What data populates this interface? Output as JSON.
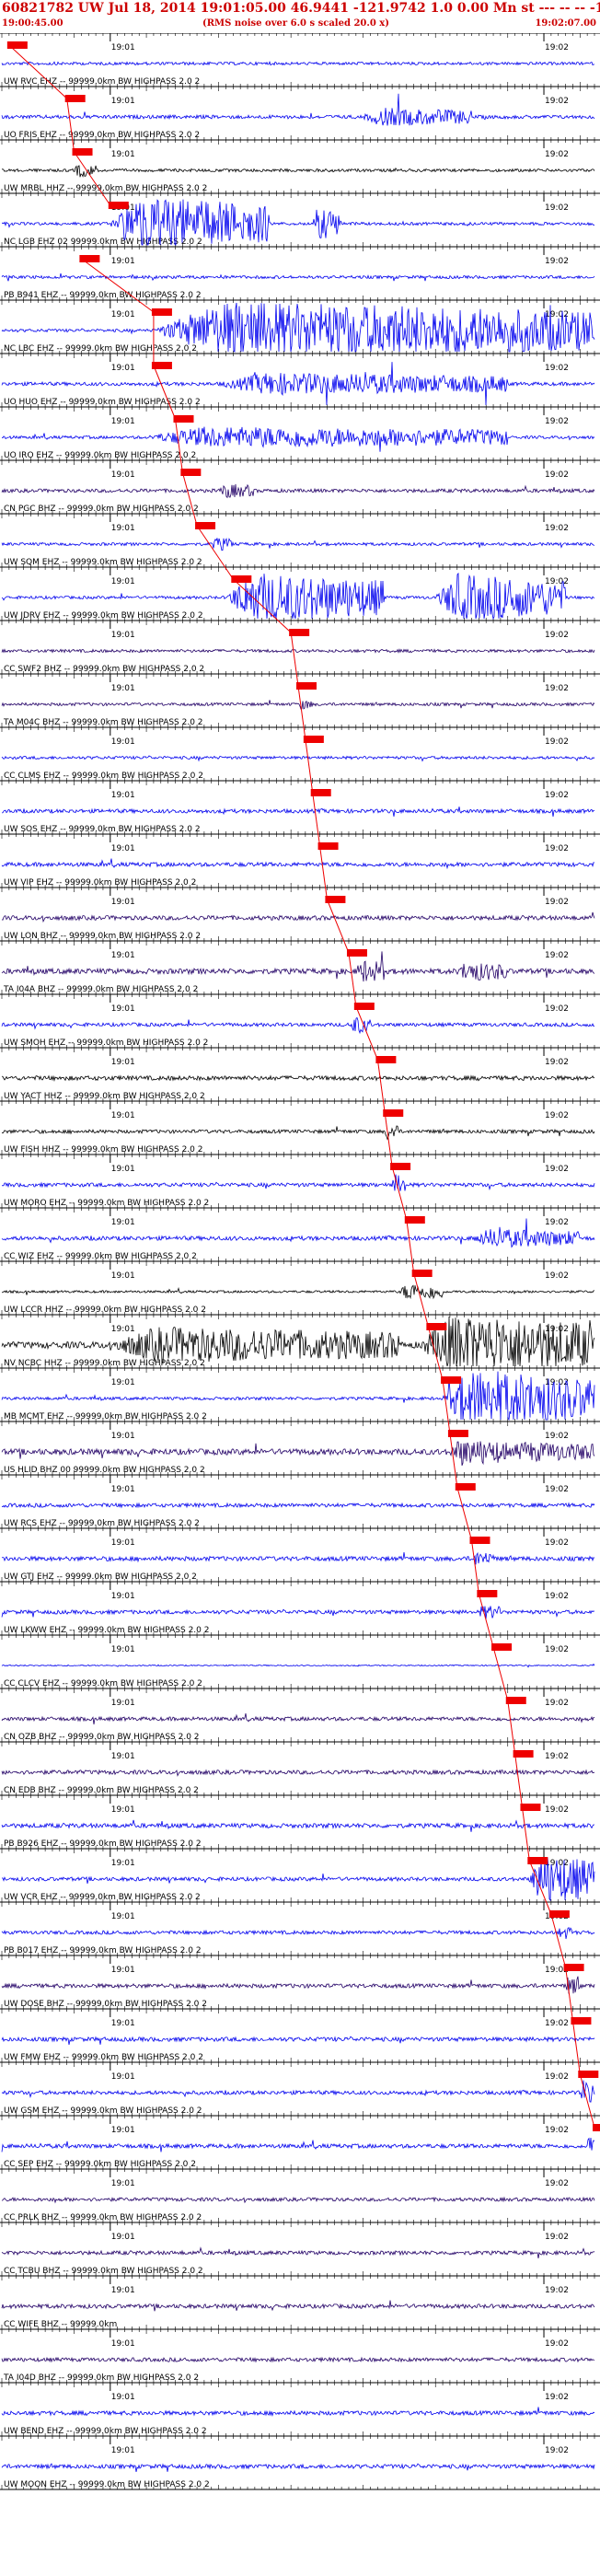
{
  "header": {
    "title": "60821782 UW Jul 18, 2014 19:01:05.00   46.9441 -121.9742  1.0 0.00 Mn st --- -- --  -1",
    "start_time": "19:00:45.00",
    "noise_note": "(RMS noise over 6.0 s scaled 20.0 x)",
    "end_time": "19:02:07.00"
  },
  "colors": {
    "pick": "#ee0000",
    "blue": "#0000ee",
    "dark": "#220066",
    "black": "#000000"
  },
  "chart_data": {
    "type": "line",
    "x_range": [
      "19:00:45.00",
      "19:02:07.00"
    ],
    "tick_labels": [
      "19:01",
      "19:02"
    ],
    "origin_time": "19:01:05.00",
    "traces": [
      {
        "label": "UW RVC EHZ -- 99999.0km BW  HIGHPASS  2.0  2",
        "pick": "19:00:46",
        "amp": 1.0,
        "burst": [],
        "color": "blue"
      },
      {
        "label": "UO FRIS EHZ -- 99999.0km BW  HIGHPASS  2.0  2",
        "pick": "19:00:54",
        "amp": 1.2,
        "burst": [
          [
            "19:01:35",
            "19:01:50",
            4
          ]
        ],
        "color": "blue"
      },
      {
        "label": "UW MRBL HHZ -- 99999.0km BW  HIGHPASS  2.0  2",
        "pick": "19:00:55",
        "amp": 1.0,
        "burst": [
          [
            "19:00:55",
            "19:00:58",
            3
          ]
        ],
        "color": "black"
      },
      {
        "label": "NC LGB EHZ 02 99999.0km BW  HIGHPASS  2.0  2",
        "pick": "19:01:00",
        "amp": 1.0,
        "burst": [
          [
            "19:01:00",
            "19:01:22",
            14
          ],
          [
            "19:01:28",
            "19:01:32",
            8
          ]
        ],
        "color": "blue"
      },
      {
        "label": "PB B941 EHZ -- 99999.0km BW  HIGHPASS  2.0  2",
        "pick": "19:00:56",
        "amp": 1.0,
        "burst": [],
        "color": "blue"
      },
      {
        "label": "NC LBC EHZ -- 99999.0km BW  HIGHPASS  2.0  2",
        "pick": "19:01:06",
        "amp": 1.0,
        "burst": [
          [
            "19:01:06",
            "19:02:07",
            15
          ]
        ],
        "color": "blue"
      },
      {
        "label": "UO HUO EHZ -- 99999.0km BW  HIGHPASS  2.0  2",
        "pick": "19:01:06",
        "amp": 1.2,
        "burst": [
          [
            "19:01:15",
            "19:01:55",
            5
          ]
        ],
        "color": "blue"
      },
      {
        "label": "UO IRO EHZ -- 99999.0km BW  HIGHPASS  2.0  2",
        "pick": "19:01:09",
        "amp": 1.0,
        "burst": [
          [
            "19:01:05",
            "19:01:55",
            5
          ]
        ],
        "color": "blue"
      },
      {
        "label": "CN PGC BHZ -- 99999.0km BW  HIGHPASS  2.0  2",
        "pick": "19:01:10",
        "amp": 1.2,
        "burst": [
          [
            "19:01:15",
            "19:01:20",
            3
          ]
        ],
        "color": "dark"
      },
      {
        "label": "UW SQM EHZ -- 99999.0km BW  HIGHPASS  2.0  2",
        "pick": "19:01:12",
        "amp": 1.0,
        "burst": [
          [
            "19:01:14",
            "19:01:17",
            3
          ]
        ],
        "color": "blue"
      },
      {
        "label": "UW JDRV EHZ -- 99999.0km BW  HIGHPASS  2.0  2",
        "pick": "19:01:17",
        "amp": 1.0,
        "burst": [
          [
            "19:01:16",
            "19:01:38",
            13
          ],
          [
            "19:01:45",
            "19:02:03",
            12
          ]
        ],
        "color": "blue"
      },
      {
        "label": "CC SWF2 BHZ -- 99999.0km BW  HIGHPASS  2.0  2",
        "pick": "19:01:25",
        "amp": 1.0,
        "burst": [],
        "color": "dark"
      },
      {
        "label": "TA M04C BHZ -- 99999.0km BW  HIGHPASS  2.0  2",
        "pick": "19:01:26",
        "amp": 1.0,
        "burst": [
          [
            "19:01:26",
            "19:01:28",
            2
          ]
        ],
        "color": "dark"
      },
      {
        "label": "CC CLMS EHZ -- 99999.0km BW  HIGHPASS  2.0  2",
        "pick": "19:01:27",
        "amp": 1.0,
        "burst": [],
        "color": "blue"
      },
      {
        "label": "UW SOS EHZ -- 99999.0km BW  HIGHPASS  2.0  2",
        "pick": "19:01:28",
        "amp": 1.3,
        "burst": [],
        "color": "blue"
      },
      {
        "label": "UW VIP EHZ -- 99999.0km BW  HIGHPASS  2.0  2",
        "pick": "19:01:29",
        "amp": 1.4,
        "burst": [],
        "color": "blue"
      },
      {
        "label": "UW LON BHZ -- 99999.0km BW  HIGHPASS  2.0  2",
        "pick": "19:01:30",
        "amp": 1.5,
        "burst": [],
        "color": "dark"
      },
      {
        "label": "TA I04A BHZ -- 99999.0km BW  HIGHPASS  2.0  2",
        "pick": "19:01:33",
        "amp": 1.8,
        "burst": [
          [
            "19:01:34",
            "19:01:38",
            5
          ],
          [
            "19:01:48",
            "19:01:55",
            4
          ]
        ],
        "color": "dark"
      },
      {
        "label": "UW SMOH EHZ -- 99999.0km BW  HIGHPASS  2.0  2",
        "pick": "19:01:34",
        "amp": 1.2,
        "burst": [
          [
            "19:01:33",
            "19:01:36",
            4
          ]
        ],
        "color": "blue"
      },
      {
        "label": "UW YACT HHZ -- 99999.0km BW  HIGHPASS  2.0  2",
        "pick": "19:01:37",
        "amp": 1.5,
        "burst": [],
        "color": "black"
      },
      {
        "label": "UW FISH HHZ -- 99999.0km BW  HIGHPASS  2.0  2",
        "pick": "19:01:38",
        "amp": 1.2,
        "burst": [
          [
            "19:01:38",
            "19:01:40",
            4
          ]
        ],
        "color": "black"
      },
      {
        "label": "UW MORO EHZ -- 99999.0km BW  HIGHPASS  2.0  2",
        "pick": "19:01:39",
        "amp": 1.3,
        "burst": [
          [
            "19:01:39",
            "19:01:41",
            5
          ]
        ],
        "color": "blue"
      },
      {
        "label": "CC WIZ EHZ -- 99999.0km BW  HIGHPASS  2.0  2",
        "pick": "19:01:41",
        "amp": 1.4,
        "burst": [
          [
            "19:01:50",
            "19:02:05",
            4
          ]
        ],
        "color": "blue"
      },
      {
        "label": "UW LCCR HHZ -- 99999.0km BW  HIGHPASS  2.0  2",
        "pick": "19:01:42",
        "amp": 0.8,
        "burst": [
          [
            "19:01:40",
            "19:01:46",
            4
          ]
        ],
        "color": "black"
      },
      {
        "label": "NV NCBC HHZ -- 99999.0km BW  HIGHPASS  2.0  2",
        "pick": "19:01:44",
        "amp": 2.2,
        "burst": [
          [
            "19:01:00",
            "19:01:40",
            8
          ],
          [
            "19:01:43",
            "19:02:07",
            15
          ]
        ],
        "color": "black"
      },
      {
        "label": "MB MCMT EHZ -- 99999.0km BW  HIGHPASS  2.0  2",
        "pick": "19:01:46",
        "amp": 1.0,
        "burst": [
          [
            "19:01:46",
            "19:02:07",
            15
          ]
        ],
        "color": "blue"
      },
      {
        "label": "US HLID BHZ 00 99999.0km BW  HIGHPASS  2.0  2",
        "pick": "19:01:47",
        "amp": 2.0,
        "burst": [
          [
            "19:01:47",
            "19:01:55",
            6
          ],
          [
            "19:01:55",
            "19:02:07",
            4
          ]
        ],
        "color": "dark"
      },
      {
        "label": "UW RCS EHZ -- 99999.0km BW  HIGHPASS  2.0  2",
        "pick": "19:01:48",
        "amp": 1.3,
        "burst": [],
        "color": "blue"
      },
      {
        "label": "UW GTJ EHZ -- 99999.0km BW  HIGHPASS  2.0  2",
        "pick": "19:01:50",
        "amp": 1.5,
        "burst": [
          [
            "19:01:50",
            "19:01:53",
            3
          ]
        ],
        "color": "blue"
      },
      {
        "label": "UW LKWW EHZ -- 99999.0km BW  HIGHPASS  2.0  2",
        "pick": "19:01:51",
        "amp": 1.3,
        "burst": [
          [
            "19:01:51",
            "19:01:54",
            3
          ]
        ],
        "color": "blue"
      },
      {
        "label": "CC CLCV EHZ -- 99999.0km BW  HIGHPASS  2.0  2",
        "pick": "19:01:53",
        "amp": 0.4,
        "burst": [],
        "color": "blue"
      },
      {
        "label": "CN OZB BHZ -- 99999.0km BW  HIGHPASS  2.0  2",
        "pick": "19:01:55",
        "amp": 1.3,
        "burst": [],
        "color": "dark"
      },
      {
        "label": "CN EDB BHZ -- 99999.0km BW  HIGHPASS  2.0  2",
        "pick": "19:01:56",
        "amp": 1.4,
        "burst": [],
        "color": "dark"
      },
      {
        "label": "PB B926 EHZ -- 99999.0km BW  HIGHPASS  2.0  2",
        "pick": "19:01:57",
        "amp": 1.5,
        "burst": [],
        "color": "blue"
      },
      {
        "label": "UW VCR EHZ -- 99999.0km BW  HIGHPASS  2.0  2",
        "pick": "19:01:58",
        "amp": 1.3,
        "burst": [
          [
            "19:01:58",
            "19:02:07",
            13
          ]
        ],
        "color": "blue"
      },
      {
        "label": "PB B017 EHZ -- 99999.0km BW  HIGHPASS  2.0  2",
        "pick": "19:02:01",
        "amp": 1.2,
        "burst": [
          [
            "19:02:02",
            "19:02:04",
            3
          ]
        ],
        "color": "blue"
      },
      {
        "label": "UW DOSE BHZ -- 99999.0km BW  HIGHPASS  2.0  2",
        "pick": "19:02:03",
        "amp": 1.4,
        "burst": [
          [
            "19:02:03",
            "19:02:05",
            4
          ]
        ],
        "color": "dark"
      },
      {
        "label": "UW FMW EHZ -- 99999.0km BW  HIGHPASS  2.0  2",
        "pick": "19:02:04",
        "amp": 1.4,
        "burst": [],
        "color": "blue"
      },
      {
        "label": "UW GSM EHZ -- 99999.0km BW  HIGHPASS  2.0  2",
        "pick": "19:02:05",
        "amp": 1.3,
        "burst": [
          [
            "19:02:05",
            "19:02:07",
            6
          ]
        ],
        "color": "blue"
      },
      {
        "label": "CC SEP EHZ -- 99999.0km BW  HIGHPASS  2.0  2",
        "pick": "19:02:07",
        "amp": 1.4,
        "burst": [
          [
            "19:02:06",
            "19:02:07",
            5
          ]
        ],
        "color": "blue"
      },
      {
        "label": "CC PRLK BHZ -- 99999.0km BW  HIGHPASS  2.0  2",
        "pick": "",
        "amp": 1.2,
        "burst": [],
        "color": "dark"
      },
      {
        "label": "CC TCBU BHZ -- 99999.0km BW  HIGHPASS  2.0  2",
        "pick": "",
        "amp": 1.3,
        "burst": [],
        "color": "dark"
      },
      {
        "label": "CC WIFE BHZ -- 99999.0km",
        "pick": "",
        "amp": 1.4,
        "burst": [],
        "color": "dark"
      },
      {
        "label": "TA I04D BHZ -- 99999.0km BW  HIGHPASS  2.0  2",
        "pick": "",
        "amp": 1.3,
        "burst": [],
        "color": "dark"
      },
      {
        "label": "UW BEND EHZ -- 99999.0km BW  HIGHPASS  2.0  2",
        "pick": "",
        "amp": 1.4,
        "burst": [],
        "color": "blue"
      },
      {
        "label": "UW MOON EHZ -- 99999.0km BW  HIGHPASS  2.0  2",
        "pick": "",
        "amp": 1.4,
        "burst": [],
        "color": "blue"
      }
    ]
  }
}
